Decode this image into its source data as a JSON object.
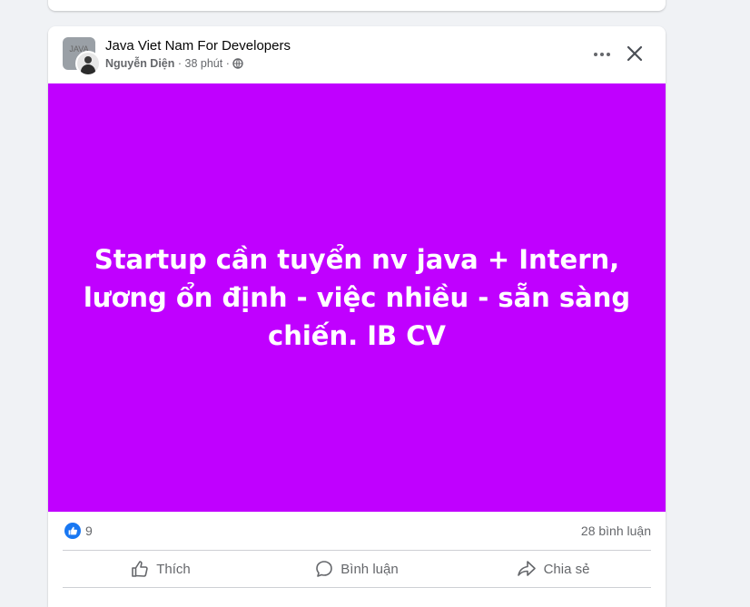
{
  "post": {
    "group_name": "Java Viet Nam For Developers",
    "group_avatar_text": "JAVA",
    "author": "Nguyễn Diện",
    "separator": " · ",
    "time": "38 phút",
    "banner_text": "Startup cần tuyển nv java + Intern, lương ổn định - việc nhiều - sẵn sàng chiến. IB CV",
    "banner_color": "#c000ff",
    "reactions_count": "9",
    "comments_count": "28 bình luận"
  },
  "actions": {
    "like_label": "Thích",
    "comment_label": "Bình luận",
    "share_label": "Chia sẻ"
  },
  "icons": {
    "more": "more-horizontal-icon",
    "close": "close-icon",
    "privacy": "globe-icon",
    "like_reaction": "like-reaction-icon",
    "like": "thumbs-up-icon",
    "comment": "comment-bubble-icon",
    "share": "share-arrow-icon"
  }
}
